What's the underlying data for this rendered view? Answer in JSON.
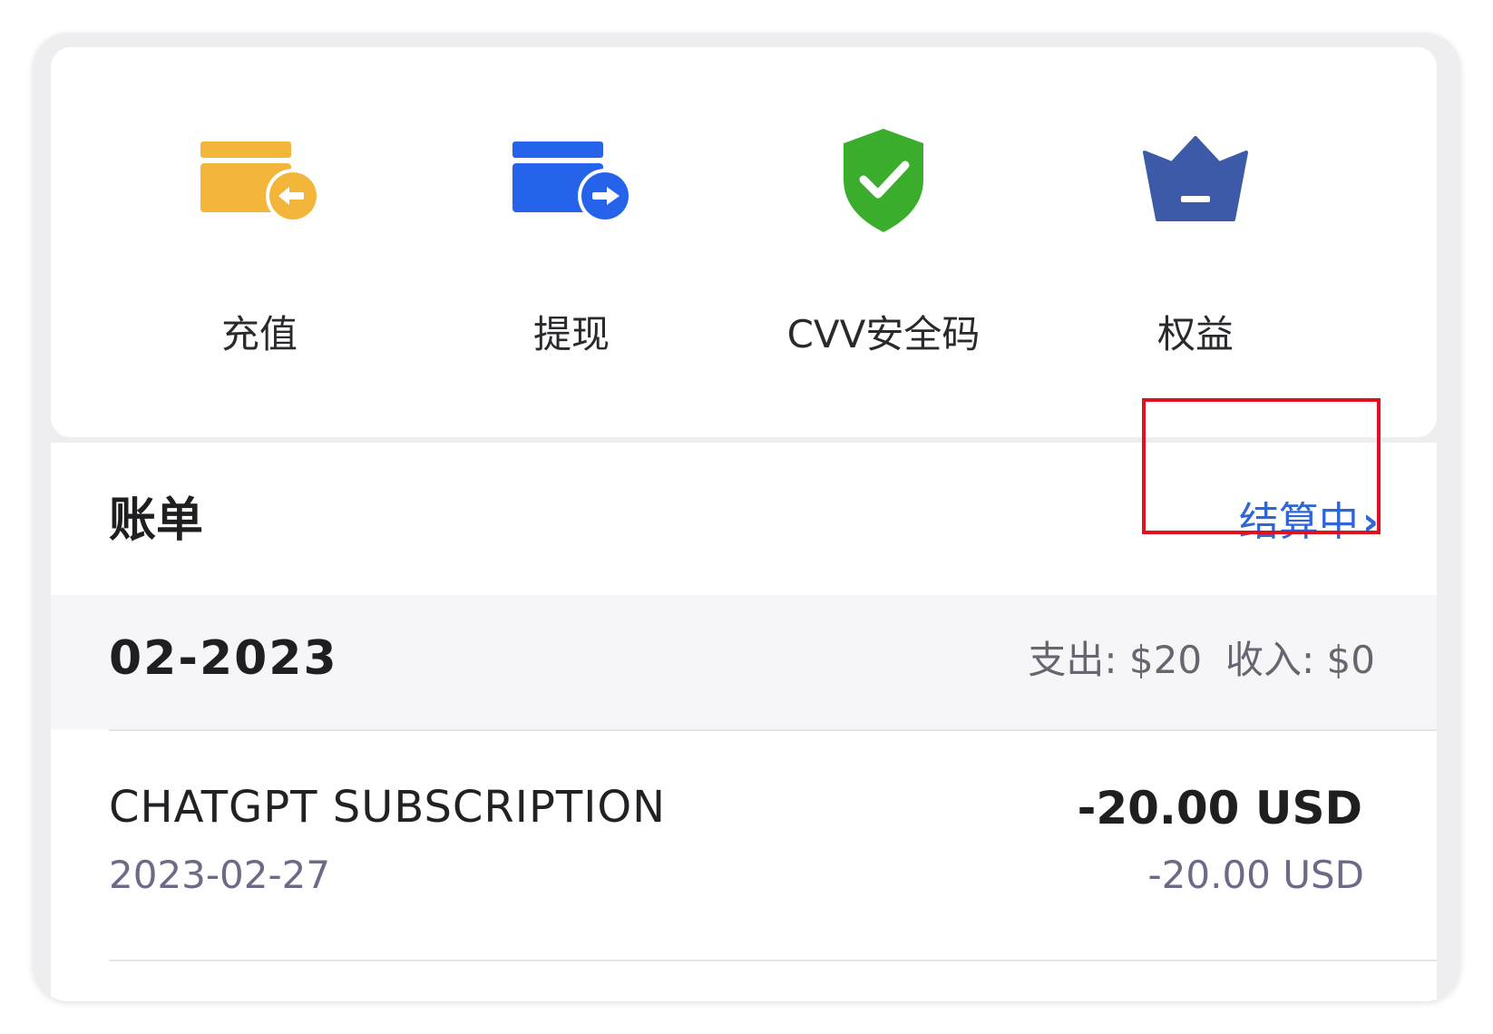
{
  "actions": [
    {
      "label": "充值",
      "icon": "card-arrow-in-icon",
      "color": "#f4b63a"
    },
    {
      "label": "提现",
      "icon": "card-arrow-out-icon",
      "color": "#2563eb"
    },
    {
      "label": "CVV安全码",
      "icon": "shield-check-icon",
      "color": "#3aad2d"
    },
    {
      "label": "权益",
      "icon": "crown-icon",
      "color": "#3d5aa8"
    }
  ],
  "bill": {
    "title": "账单",
    "link_label": "结算中",
    "link_color": "#2f66d6",
    "month": "02-2023",
    "expense_label": "支出: $20",
    "income_label": "收入: $0",
    "transactions": [
      {
        "merchant": "CHATGPT SUBSCRIPTION",
        "date": "2023-02-27",
        "amount": "-20.00 USD",
        "amount_original": "-20.00 USD"
      }
    ]
  }
}
